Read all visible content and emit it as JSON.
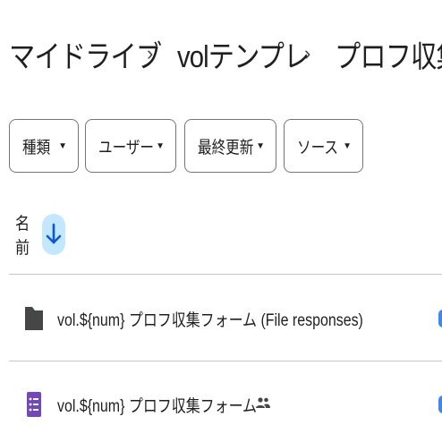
{
  "breadcrumb": {
    "items": [
      "マイドライブ",
      "volテンプレ",
      "プロフ収集"
    ],
    "separator": "›"
  },
  "filters": {
    "type_label": "種類",
    "user_label": "ユーザー",
    "modified_label": "最終更新",
    "source_label": "ソース"
  },
  "sort": {
    "label": "名前",
    "direction": "descending"
  },
  "files": [
    {
      "name": "vol.${num} プロフ収集フォーム (File responses)",
      "icon": "folder-icon",
      "shared": false
    },
    {
      "name": "vol.${num} プロフ収集フォーム",
      "icon": "forms-icon",
      "shared": true
    }
  ],
  "colors": {
    "text": "#1f1f1f",
    "chip_border": "#747775",
    "sort_highlight": "#c2e7ff",
    "sort_arrow": "#0b57d0",
    "forms_purple": "#7248b9",
    "folder": "#444746",
    "divider": "#c4c7c5"
  }
}
